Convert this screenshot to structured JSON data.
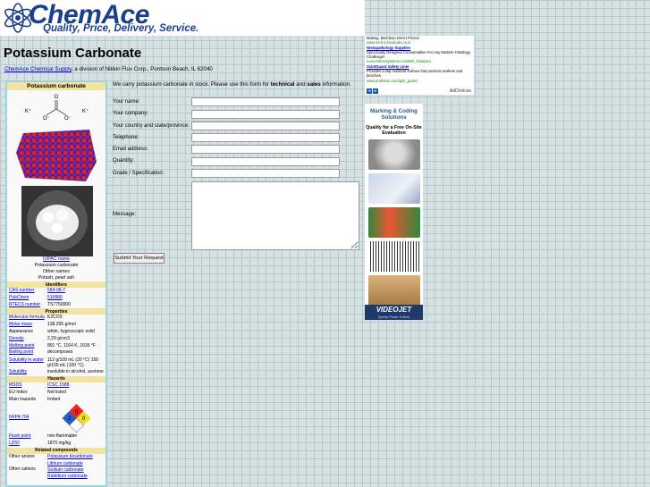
{
  "header": {
    "logo_text": "ChemAce",
    "tagline": "Quality, Price, Delivery, Service."
  },
  "page": {
    "title": "Potassium Carbonate",
    "company_link": "ChemAce Chemical Supply",
    "company_rest": ", a division of Nikkin Flux Corp., Pontoon Beach, IL 62040"
  },
  "infobox": {
    "title": "Potassium carbonate",
    "iupac_label": "IUPAC name",
    "iupac_value": "Potassium carbonate",
    "other_label": "Other names",
    "other_value": "Potash, pearl ash",
    "identifiers_header": "Identifiers",
    "identifiers": [
      {
        "key": "CAS number",
        "value": "584-08-7"
      },
      {
        "key": "PubChem",
        "value": "516886"
      },
      {
        "key": "RTECS number",
        "value": "TS7750000"
      }
    ],
    "properties_header": "Properties",
    "properties": [
      {
        "key": "Molecular formula",
        "value": "K2CO3"
      },
      {
        "key": "Molar mass",
        "value": "138.205 g/mol"
      },
      {
        "key": "Appearance",
        "value": "white, hygroscopic solid"
      },
      {
        "key": "Density",
        "value": "2.29 g/cm3"
      },
      {
        "key": "Melting point",
        "value": "891 °C, 1164 K, 1636 °F"
      },
      {
        "key": "Boiling point",
        "value": "decomposes"
      },
      {
        "key": "Solubility in water",
        "value": "112 g/100 mL (20 °C) 156 g/100 mL (100 °C)"
      },
      {
        "key": "Solubility",
        "value": "insoluble in alcohol, acetone"
      }
    ],
    "hazards_header": "Hazards",
    "hazards": [
      {
        "key": "MSDS",
        "value": "ICSC 1588"
      },
      {
        "key": "EU Index",
        "value": "Not listed"
      },
      {
        "key": "Main hazards",
        "value": "Irritant"
      }
    ],
    "nfpa_label": "NFPA 704",
    "nfpa": {
      "fire": "0",
      "health": "2",
      "reactivity": "0"
    },
    "hazards2": [
      {
        "key": "Flash point",
        "value": "non-flammable"
      },
      {
        "key": "LD50",
        "value": "1870 mg/kg"
      }
    ],
    "related_header": "Related compounds",
    "other_anions_label": "Other anions",
    "other_anions_value": "Potassium bicarbonate",
    "other_cations_label": "Other cations",
    "other_cations": [
      "Lithium carbonate",
      "Sodium carbonate",
      "Rubidium carbonate"
    ]
  },
  "form": {
    "intro_a": "We carry potassium carbonate in stock. Please use this form for ",
    "intro_b": "technical",
    "intro_c": " and ",
    "intro_d": "sales",
    "intro_e": " information.",
    "name_label": "Your name:",
    "company_label": "Your company:",
    "country_label": "Your country and state/province:",
    "phone_label": "Telephone:",
    "email_label": "Email address:",
    "qty_label": "Quantity:",
    "grade_label": "Grade / Specification:",
    "message_label": "Message:",
    "submit_label": "Submit Your Request"
  },
  "ad_top": {
    "line1": "Making. BioClean Direct Prices!",
    "url1": "www.SAS-Chemicals.co.in",
    "title2": "Histopathology Supplies",
    "desc2": "Specifically Designed Consumables For Any Modern Histology Challenge!",
    "url2": "Leica-Microsystems.com/BR_Glassoni",
    "title3": "ScintGuard Safety Liner",
    "desc3": "Provides a slip resistant surface that protects workers and benches.",
    "url3": "www.protheon.com/gdc_guard",
    "adchoices": "AdChoices"
  },
  "ad_side": {
    "headline": "Marking & Coding Solutions",
    "sub": "Quality for a Free On-Site Evaluation",
    "brand": "VIDEOJET",
    "brand_sub": "Sprinks Power of Mind"
  }
}
